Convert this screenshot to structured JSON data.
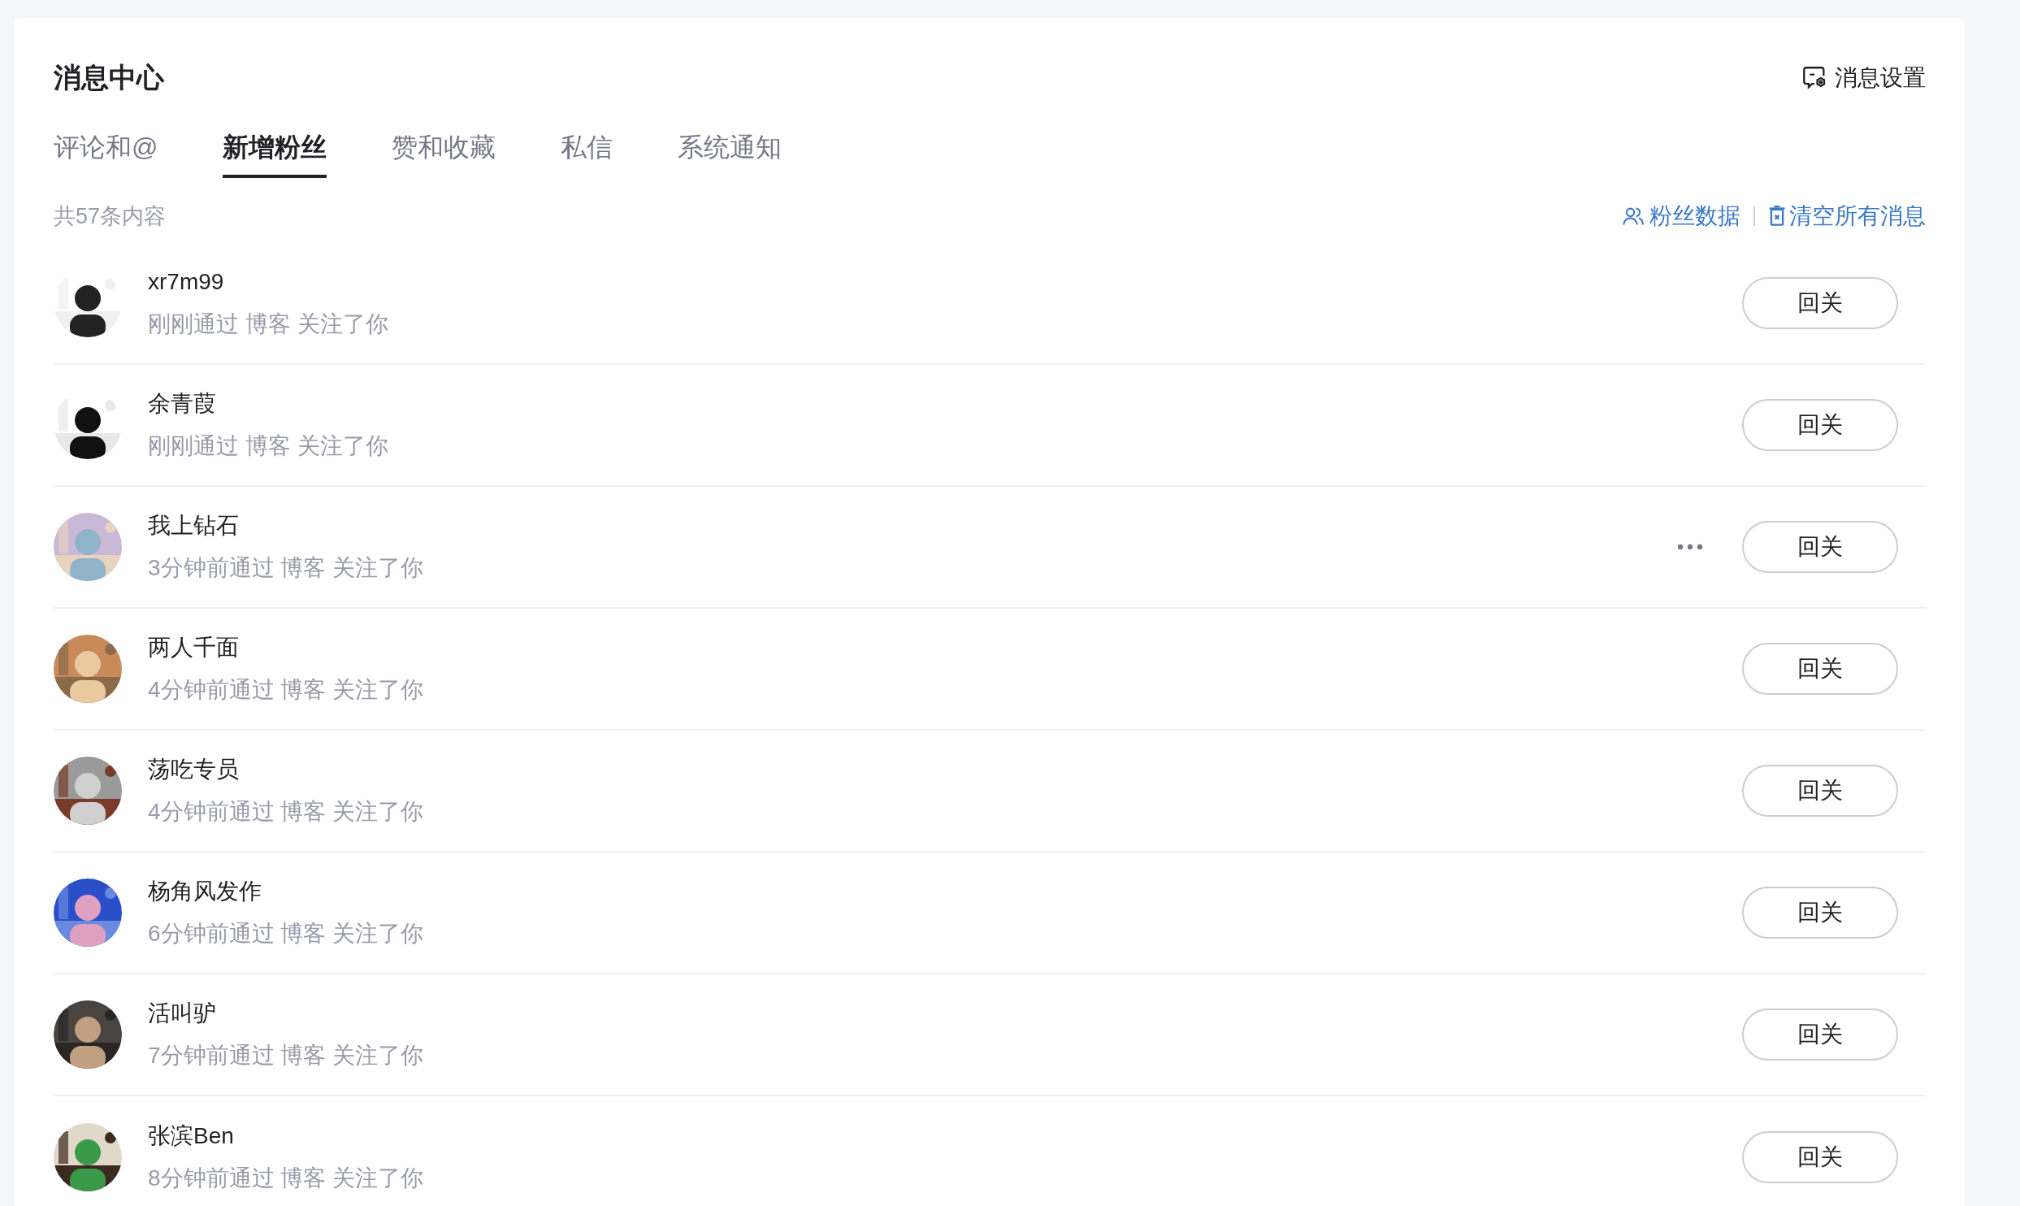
{
  "header": {
    "title": "消息中心",
    "settings_link": "消息设置"
  },
  "tabs": [
    {
      "label": "评论和@",
      "selected": false
    },
    {
      "label": "新增粉丝",
      "selected": true
    },
    {
      "label": "赞和收藏",
      "selected": false
    },
    {
      "label": "私信",
      "selected": false
    },
    {
      "label": "系统通知",
      "selected": false
    }
  ],
  "summary": {
    "count": "共57条内容",
    "fan_data_link": "粉丝数据",
    "clear_link": "清空所有消息"
  },
  "followers": [
    {
      "name": "xr7m99",
      "detail": "刚刚通过 博客 关注了你",
      "show_more": false,
      "button": "回关"
    },
    {
      "name": "余青葭",
      "detail": "刚刚通过 博客 关注了你",
      "show_more": false,
      "button": "回关"
    },
    {
      "name": "我上钻石",
      "detail": "3分钟前通过 博客 关注了你",
      "show_more": true,
      "button": "回关"
    },
    {
      "name": "两人千面",
      "detail": "4分钟前通过 博客 关注了你",
      "show_more": false,
      "button": "回关"
    },
    {
      "name": "荡吃专员",
      "detail": "4分钟前通过 博客 关注了你",
      "show_more": false,
      "button": "回关"
    },
    {
      "name": "杨角风发作",
      "detail": "6分钟前通过 博客 关注了你",
      "show_more": false,
      "button": "回关"
    },
    {
      "name": "活叫驴",
      "detail": "7分钟前通过 博客 关注了你",
      "show_more": false,
      "button": "回关"
    },
    {
      "name": "张滨Ben",
      "detail": "8分钟前通过 博客 关注了你",
      "show_more": false,
      "button": "回关"
    }
  ]
}
